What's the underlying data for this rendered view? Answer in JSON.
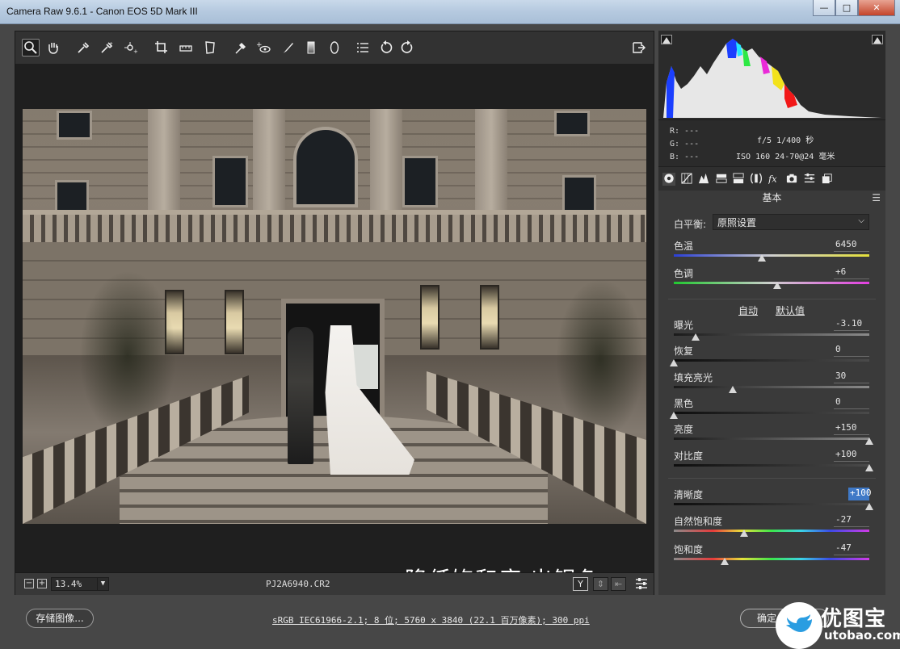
{
  "window": {
    "title": "Camera Raw 9.6.1 - Canon EOS 5D Mark III",
    "min_label": "—",
    "max_label": "□",
    "close_label": "✕"
  },
  "toolbar": {
    "tools": [
      "zoom-icon",
      "hand-icon",
      "white-balance-icon",
      "color-sampler-icon",
      "targeted-adjustment-icon",
      "crop-icon",
      "straighten-icon",
      "transform-icon",
      "spot-removal-icon",
      "red-eye-icon",
      "adjustment-brush-icon",
      "graduated-filter-icon",
      "radial-filter-icon",
      "preferences-icon",
      "rotate-left-icon",
      "rotate-right-icon"
    ],
    "active_tool": "zoom-icon",
    "fullscreen_icon": "fullscreen-icon"
  },
  "preview": {
    "overlay_caption": "降低饱和度 出银色",
    "warning_icon": "warning-icon"
  },
  "statusbar": {
    "zoom_out_label": "−",
    "zoom_in_label": "+",
    "zoom_level": "13.4%",
    "filename": "PJ2A6940.CR2",
    "view_y_label": "Y",
    "view_swap_label": "⇕",
    "view_copy_label": "⇤",
    "settings_icon": "toggle-settings-icon"
  },
  "histogram": {
    "colors": {
      "blue": "#1b3fff",
      "cyan": "#25e6ff",
      "yellow": "#f3e21b",
      "red": "#f21818",
      "magenta": "#ea2ad8",
      "green": "#2ee844"
    }
  },
  "info": {
    "r": "R:  ---",
    "g": "G:  ---",
    "b": "B:  ---",
    "exposure": "f/5  1/400 秒",
    "iso_lens": "ISO 160   24-70@24 毫米"
  },
  "panel": {
    "title": "基本",
    "white_balance_label": "白平衡:",
    "white_balance_value": "原照设置",
    "auto_link": "自动",
    "default_link": "默认值",
    "sliders": [
      {
        "id": "temperature",
        "label": "色温",
        "value": "6450",
        "pos": 0.45,
        "track": "temp"
      },
      {
        "id": "tint",
        "label": "色调",
        "value": "+6",
        "pos": 0.53,
        "track": "tint"
      },
      {
        "id": "exposure",
        "label": "曝光",
        "value": "-3.10",
        "pos": 0.11,
        "track": "light"
      },
      {
        "id": "recovery",
        "label": "恢复",
        "value": "0",
        "pos": 0.0,
        "track": "dark"
      },
      {
        "id": "fill-light",
        "label": "填充亮光",
        "value": "30",
        "pos": 0.3,
        "track": "light"
      },
      {
        "id": "blacks",
        "label": "黑色",
        "value": "0",
        "pos": 0.0,
        "track": "dark"
      },
      {
        "id": "brightness",
        "label": "亮度",
        "value": "+150",
        "pos": 1.0,
        "track": "light"
      },
      {
        "id": "contrast",
        "label": "对比度",
        "value": "+100",
        "pos": 1.0,
        "track": "dark"
      },
      {
        "id": "clarity",
        "label": "清晰度",
        "value": "+100",
        "pos": 1.0,
        "track": "dark"
      },
      {
        "id": "vibrance",
        "label": "自然饱和度",
        "value": "-27",
        "pos": 0.36,
        "track": "rainbow"
      },
      {
        "id": "saturation",
        "label": "饱和度",
        "value": "-47",
        "pos": 0.26,
        "track": "rainbow"
      }
    ]
  },
  "footer": {
    "save_label": "存储图像...",
    "workflow_link": "sRGB IEC61966-2.1; 8 位; 5760 x 3840 (22.1 百万像素); 300 ppi",
    "ok_label": "确定"
  },
  "brand": {
    "cn": "优图宝",
    "en": "utobao.com"
  }
}
